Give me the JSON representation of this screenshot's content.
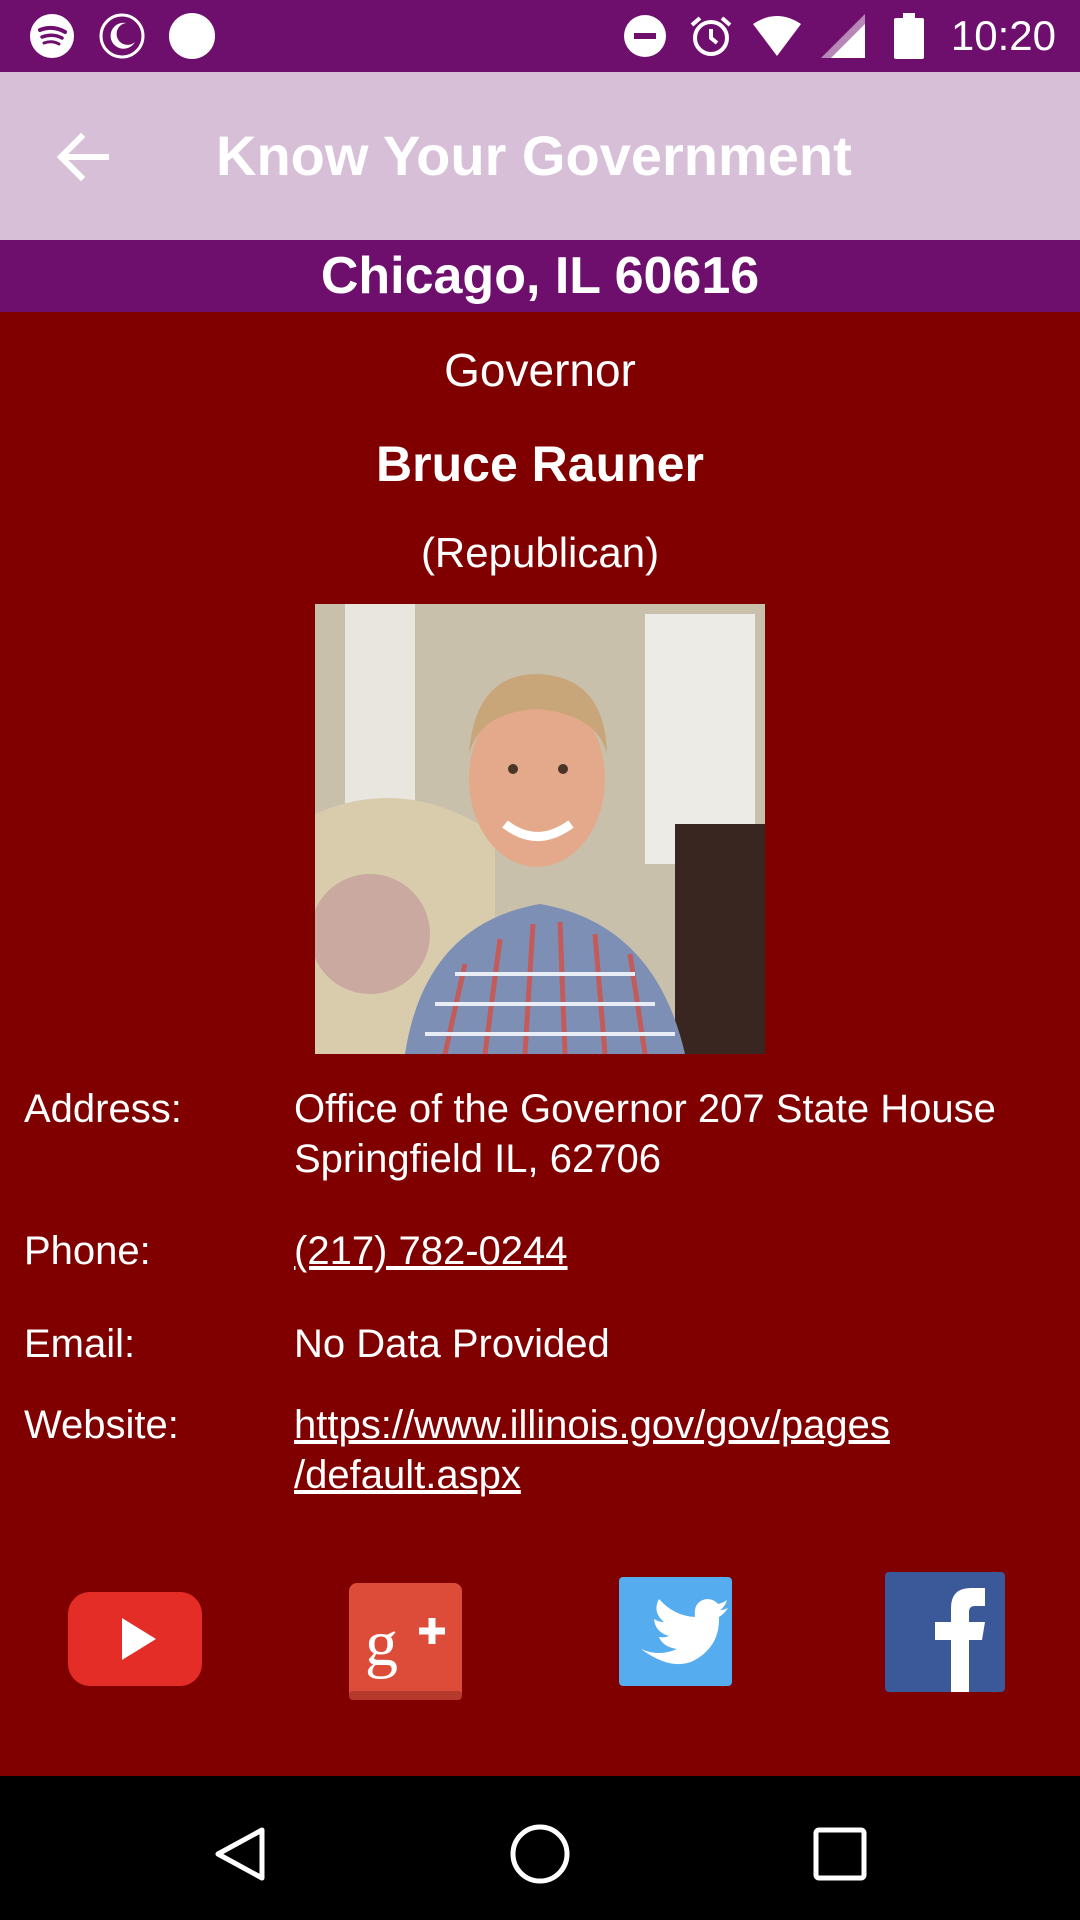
{
  "status_bar": {
    "time": "10:20",
    "icons": [
      "spotify-icon",
      "night-mode-icon",
      "circle-icon",
      "do-not-disturb-icon",
      "alarm-icon",
      "wifi-icon",
      "signal-icon",
      "battery-icon"
    ]
  },
  "app_bar": {
    "title": "Know Your Government",
    "back_icon": "arrow-back-icon"
  },
  "location": "Chicago, IL 60616",
  "official": {
    "office": "Governor",
    "name": "Bruce Rauner",
    "party": "(Republican)"
  },
  "details": {
    "address_label": "Address:",
    "address_line1": "Office of the Governor 207 State House",
    "address_line2": "Springfield IL, 62706",
    "phone_label": "Phone:",
    "phone_value": "(217) 782-0244",
    "email_label": "Email:",
    "email_value": "No Data Provided",
    "website_label": "Website:",
    "website_line1": "https://www.illinois.gov/gov/pages",
    "website_line2": "/default.aspx"
  },
  "social": [
    "youtube-icon",
    "google-plus-icon",
    "twitter-icon",
    "facebook-icon"
  ],
  "nav_bar": [
    "back-triangle-icon",
    "home-circle-icon",
    "recents-square-icon"
  ],
  "colors": {
    "status_bar": "#6e0f6e",
    "app_bar": "#d8bfd8",
    "location_bar": "#6e0f6e",
    "background": "#800000"
  }
}
